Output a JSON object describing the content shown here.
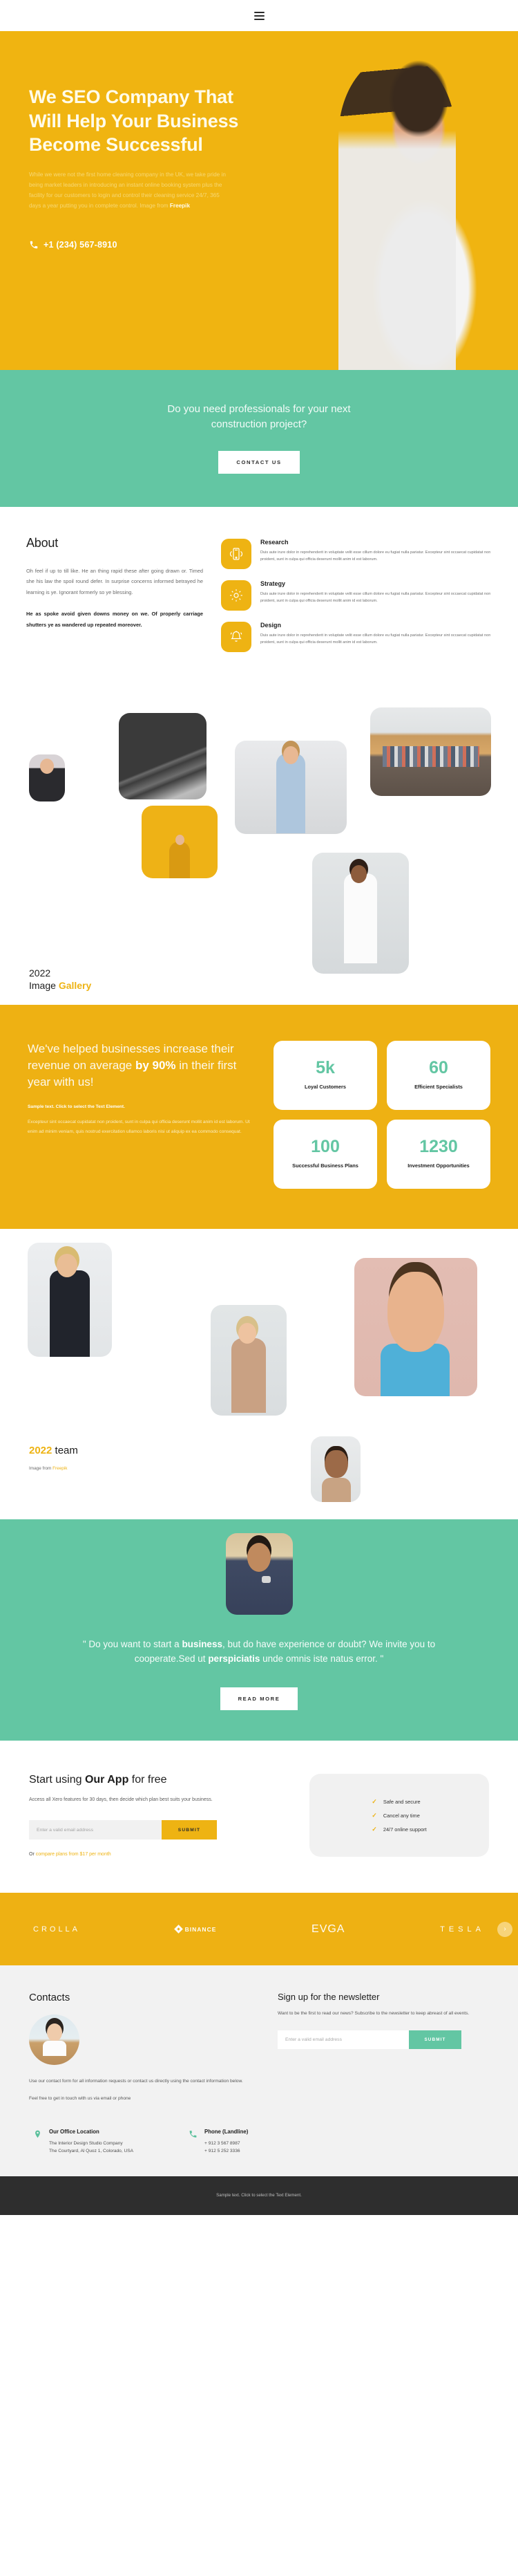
{
  "topbar": {
    "menu_icon": "hamburger-menu-icon"
  },
  "hero": {
    "heading": "We SEO Company That Will Help Your Business Become Successful",
    "paragraph": "While we were not the first home cleaning company in the UK, we take pride in being market leaders in introducing an instant online booking system plus the facility for our customers to login and control their cleaning service 24/7, 365 days a year putting you in complete control. Image from ",
    "image_credit": "Freepik",
    "phone": "+1 (234) 567-8910",
    "phone_icon": "phone-icon"
  },
  "cta": {
    "heading": "Do you need professionals for your next construction project?",
    "button": "CONTACT US"
  },
  "about": {
    "title": "About",
    "paragraph": "Oh feel if up to till like. He an thing rapid these after going drawn or. Timed she his law the spoil round defer. In surprise concerns informed betrayed he learning is ye. Ignorant formerly so ye blessing.",
    "paragraph_bold": "He as spoke avoid given downs money on we. Of properly carriage shutters ye as wandered up repeated moreover.",
    "features": [
      {
        "icon": "mobile-signal-icon",
        "title": "Research",
        "text": "Duis aute irure dolor in reprehenderit in voluptate velit esse cillum dolore eu fugiat nulla pariatur. Excepteur sint occaecat cupidatat non proident, sunt in culpa qui officia deserunt mollit anim id est laborum."
      },
      {
        "icon": "gear-icon",
        "title": "Strategy",
        "text": "Duis aute irure dolor in reprehenderit in voluptate velit esse cillum dolore eu fugiat nulla pariatur. Excepteur sint occaecat cupidatat non proident, sunt in culpa qui officia deserunt mollit anim id est laborum."
      },
      {
        "icon": "bell-icon",
        "title": "Design",
        "text": "Duis aute irure dolor in reprehenderit in voluptate velit esse cillum dolore eu fugiat nulla pariatur. Excepteur sint occaecat cupidatat non proident, sunt in culpa qui officia deserunt mollit anim id est laborum."
      }
    ]
  },
  "gallery": {
    "year": "2022",
    "title_plain": "Image ",
    "title_accent": "Gallery"
  },
  "stats": {
    "heading_pre": "We've helped businesses increase their revenue on average ",
    "heading_bold": "by 90%",
    "heading_post": " in their first year with us!",
    "sample": "Sample text. Click to select the Text Element.",
    "body": "Excepteur sint occaecat cupidatat non proident, sunt in culpa qui officia deserunt mollit anim id est laborum. Ut enim ad minim veniam, quis nostrud exercitation ullamco laboris nisi ut aliquip ex ea commodo consequat.",
    "cards": [
      {
        "value": "5k",
        "label": "Loyal Customers"
      },
      {
        "value": "60",
        "label": "Efficient Specialists"
      },
      {
        "value": "100",
        "label": "Successful Business Plans"
      },
      {
        "value": "1230",
        "label": "Investment Opportunities"
      }
    ]
  },
  "team": {
    "year": "2022",
    "word": " team",
    "credit_prefix": "Image from ",
    "credit_link": "Freepik"
  },
  "quote": {
    "avatar": "testimonial-avatar",
    "text_1": "\" Do you want to start a ",
    "bold_1": "business",
    "text_2": ", but do have experience or doubt? We invite you to cooperate.Sed ut ",
    "bold_2": "perspiciatis",
    "text_3": " unde omnis iste natus error. \"",
    "button": "READ MORE"
  },
  "trial": {
    "heading_pre": "Start using ",
    "heading_bold": "Our App",
    "heading_post": " for free",
    "subtitle": "Access all Xero features for 30 days, then decide which plan best suits your business.",
    "email_placeholder": "Enter a valid email address",
    "email_value": "",
    "submit": "SUBMIT",
    "or_text": "Or ",
    "or_link": "compare plans from $17 per month",
    "perks": [
      "Safe and secure",
      "Cancel any time",
      "24/7 online support"
    ],
    "check_icon": "check-icon"
  },
  "brands": {
    "items": [
      {
        "name": "CROLLA",
        "icon": ""
      },
      {
        "name": "BINANCE",
        "icon": "binance-diamond-icon"
      },
      {
        "name": "EVGA",
        "icon": ""
      },
      {
        "name": "TESLA",
        "icon": ""
      }
    ],
    "next_icon": "chevron-right-icon"
  },
  "footer": {
    "contacts_title": "Contacts",
    "avatar": "contacts-avatar",
    "contacts_p1": "Use our contact form for all information requests or contact us directly using the contact information below.",
    "contacts_p2": "Feel free to get in touch with us via email or phone",
    "newsletter_title": "Sign up for the newsletter",
    "newsletter_text": "Want to be the first to read our news? Subscribe to the newsletter to keep abreast of all events.",
    "newsletter_placeholder": "Enter a valid email address",
    "newsletter_value": "",
    "newsletter_submit": "SUBMIT",
    "office": {
      "icon": "map-pin-icon",
      "title": "Our Office Location",
      "line1": "The Interior Design Studio Company",
      "line2": "The Courtyard, Al Quoz 1, Colorado,  USA"
    },
    "phone": {
      "icon": "phone-icon",
      "title": "Phone (Landline)",
      "line1": "+ 912 3 567 8987",
      "line2": "+ 912 5 252 3336"
    },
    "copyright": "Sample text. Click to select the Text Element."
  },
  "colors": {
    "yellow": "#eeb113",
    "teal": "#63c6a3",
    "dark": "#2e2e2e",
    "light_grey": "#f1f1f1"
  }
}
